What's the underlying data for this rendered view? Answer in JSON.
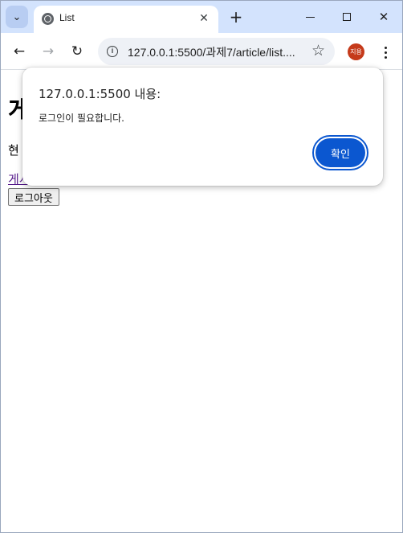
{
  "browser": {
    "tab": {
      "title": "List"
    },
    "address_bar": {
      "url": "127.0.0.1:5500/과제7/article/list...."
    },
    "profile": {
      "initials": "지용",
      "color": "#c53a1a"
    },
    "icons": {
      "tab_search": "chevron-down-icon",
      "favicon": "globe-icon",
      "tab_close": "close-icon",
      "new_tab": "plus-icon",
      "back": "arrow-left-icon",
      "forward": "arrow-right-icon",
      "reload": "reload-icon",
      "site_info": "info-icon",
      "bookmark": "star-icon",
      "menu": "more-vert-icon",
      "minimize": "minimize-icon",
      "maximize": "maximize-icon",
      "close_window": "close-icon"
    }
  },
  "page": {
    "heading": "게",
    "text": "현",
    "link": "게시",
    "logout_button": "로그아웃"
  },
  "dialog": {
    "title": "127.0.0.1:5500 내용:",
    "message": "로그인이 필요합니다.",
    "ok_button": "확인",
    "accent": "#0b57d0"
  }
}
